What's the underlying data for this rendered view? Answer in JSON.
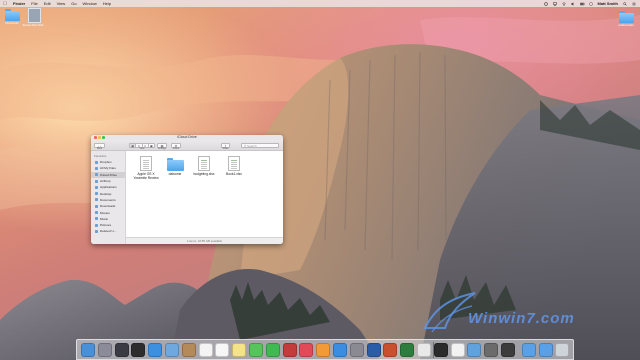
{
  "menubar": {
    "items": [
      "Finder",
      "File",
      "Edit",
      "View",
      "Go",
      "Window",
      "Help"
    ],
    "user": "Matt Smith",
    "status_icons": [
      "sync-icon",
      "airplay-icon",
      "wifi-icon",
      "volume-icon",
      "battery-icon",
      "clock-icon",
      "search-icon",
      "list-icon"
    ]
  },
  "desktop": {
    "icons": [
      {
        "label": "Documents",
        "kind": "folder-icon"
      },
      {
        "label": "Screen Shot 2014...",
        "kind": "screenshot-icon"
      },
      {
        "label": "untitled folder",
        "kind": "folder-icon"
      }
    ]
  },
  "finder": {
    "title": "iCloud Drive",
    "toolbar": {
      "back_label": "Back",
      "view_label": "View",
      "arrange_label": "Arrange",
      "action_label": "Action",
      "share_label": "Share",
      "search_placeholder": "Search"
    },
    "sidebar": {
      "favorites_header": "Favorites",
      "favorites": [
        "Dropbox",
        "All My Files",
        "iCloud Drive",
        "AirDrop",
        "Applications",
        "Desktop",
        "Documents",
        "Downloads",
        "Movies",
        "Music",
        "Pictures",
        "Deleted U..."
      ],
      "selected": "iCloud Drive"
    },
    "files": [
      {
        "name": "Apple OS X\nYosemite Review",
        "kind": "document-icon"
      },
      {
        "name": "datsome",
        "kind": "folder-icon"
      },
      {
        "name": "budgeting.xlsx",
        "kind": "spreadsheet-icon"
      },
      {
        "name": "Book1.xlsx",
        "kind": "spreadsheet-icon"
      }
    ],
    "status_text": "4 items, 18.85 GB available"
  },
  "dock": {
    "apps": [
      "finder-icon",
      "launchpad-icon",
      "mission-control-icon",
      "dashboard-icon",
      "safari-icon",
      "mail-icon",
      "contacts-icon",
      "calendar-icon",
      "reminders-icon",
      "notes-icon",
      "messages-icon",
      "facetime-icon",
      "photo-booth-icon",
      "itunes-icon",
      "ibooks-icon",
      "app-store-icon",
      "system-preferences-icon",
      "word-icon",
      "powerpoint-icon",
      "excel-icon",
      "photos-icon",
      "terminal-icon",
      "textedit-icon",
      "preview-icon",
      "calculator-icon",
      "activity-monitor-icon",
      "downloads-stack-icon",
      "documents-stack-icon",
      "trash-icon"
    ]
  },
  "watermark": {
    "text": "Winwin7.com"
  }
}
